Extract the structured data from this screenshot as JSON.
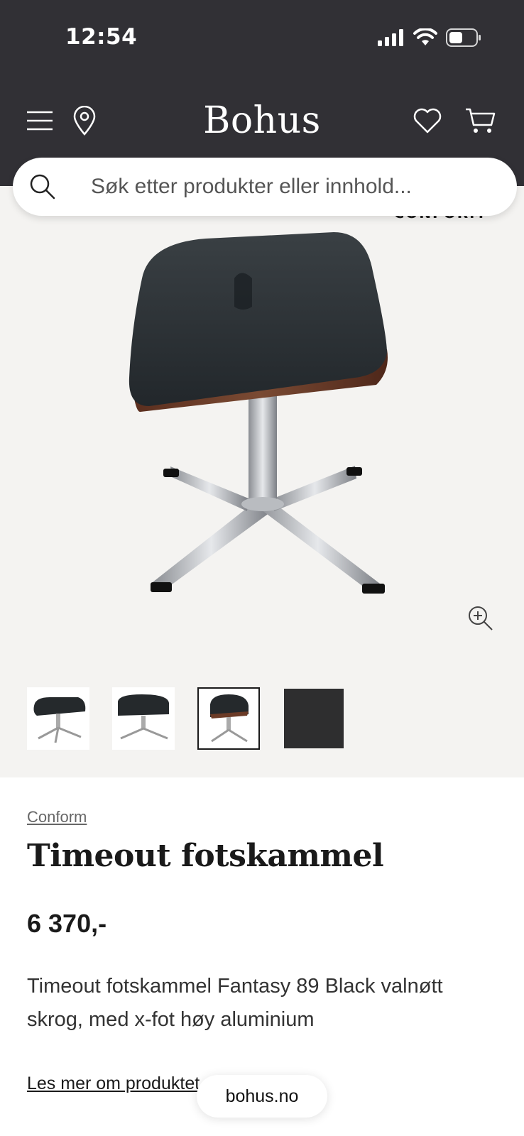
{
  "status_bar": {
    "time": "12:54"
  },
  "header": {
    "brand": "Bohus",
    "icons": [
      "menu-icon",
      "location-pin-icon",
      "heart-icon",
      "cart-icon"
    ],
    "background": "#313035"
  },
  "search": {
    "placeholder": "Søk etter produkter eller innhold..."
  },
  "gallery": {
    "thumbnails": [
      "thumb-1",
      "thumb-2",
      "thumb-3",
      "thumb-swatch"
    ],
    "selected_index": 2
  },
  "product": {
    "brand_link": "Conform",
    "title": "Timeout fotskammel",
    "price": "6 370,-",
    "description": "Timeout fotskammel Fantasy 89 Black valnøtt skrog, med x-fot høy aluminium",
    "read_more": "Les mer om produktet"
  },
  "browser": {
    "domain": "bohus.no"
  }
}
